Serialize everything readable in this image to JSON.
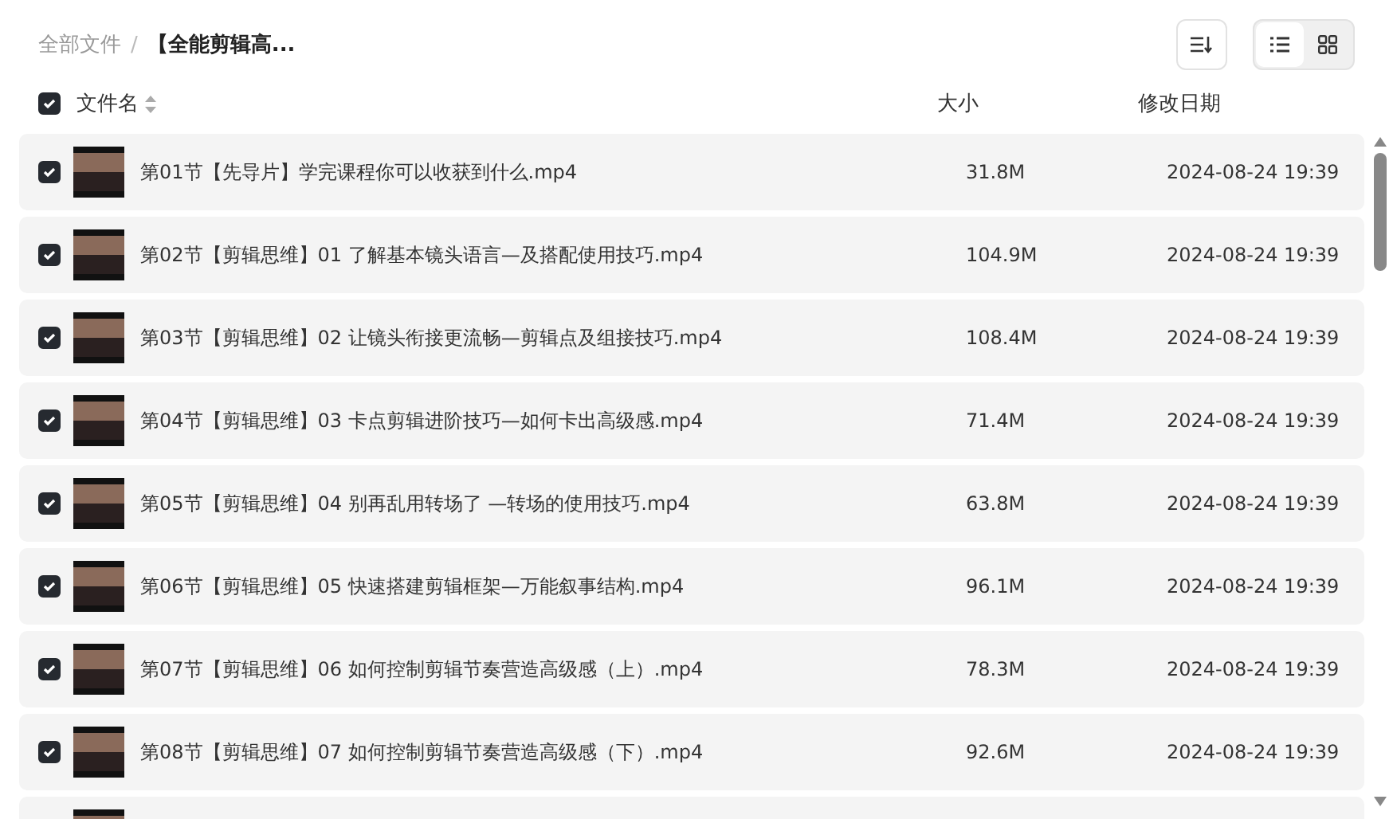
{
  "breadcrumb_separator": "/",
  "breadcrumb": [
    {
      "label": "全部文件",
      "current": false
    },
    {
      "label": "【全能剪辑高...",
      "current": true
    }
  ],
  "toolbar": {
    "view_modes": [
      {
        "kind": "list",
        "selected": true
      },
      {
        "kind": "grid",
        "selected": false
      }
    ]
  },
  "table": {
    "select_all": {
      "checked": true
    },
    "columns": [
      {
        "label": "文件名",
        "sortable": true
      },
      {
        "label": "大小",
        "sortable": false
      },
      {
        "label": "修改日期",
        "sortable": false
      }
    ],
    "rows": [
      {
        "name": "第01节【先导片】学完课程你可以收获到什么.mp4",
        "size": "31.8M",
        "modified": "2024-08-24 19:39",
        "checked": true
      },
      {
        "name": "第02节【剪辑思维】01 了解基本镜头语言—及搭配使用技巧.mp4",
        "size": "104.9M",
        "modified": "2024-08-24 19:39",
        "checked": true
      },
      {
        "name": "第03节【剪辑思维】02 让镜头衔接更流畅—剪辑点及组接技巧.mp4",
        "size": "108.4M",
        "modified": "2024-08-24 19:39",
        "checked": true
      },
      {
        "name": "第04节【剪辑思维】03 卡点剪辑进阶技巧—如何卡出高级感.mp4",
        "size": "71.4M",
        "modified": "2024-08-24 19:39",
        "checked": true
      },
      {
        "name": "第05节【剪辑思维】04 别再乱用转场了 —转场的使用技巧.mp4",
        "size": "63.8M",
        "modified": "2024-08-24 19:39",
        "checked": true
      },
      {
        "name": "第06节【剪辑思维】05 快速搭建剪辑框架—万能叙事结构.mp4",
        "size": "96.1M",
        "modified": "2024-08-24 19:39",
        "checked": true
      },
      {
        "name": "第07节【剪辑思维】06 如何控制剪辑节奏营造高级感（上）.mp4",
        "size": "78.3M",
        "modified": "2024-08-24 19:39",
        "checked": true
      },
      {
        "name": "第08节【剪辑思维】07 如何控制剪辑节奏营造高级感（下）.mp4",
        "size": "92.6M",
        "modified": "2024-08-24 19:39",
        "checked": true
      }
    ],
    "more_rows_below": true
  }
}
